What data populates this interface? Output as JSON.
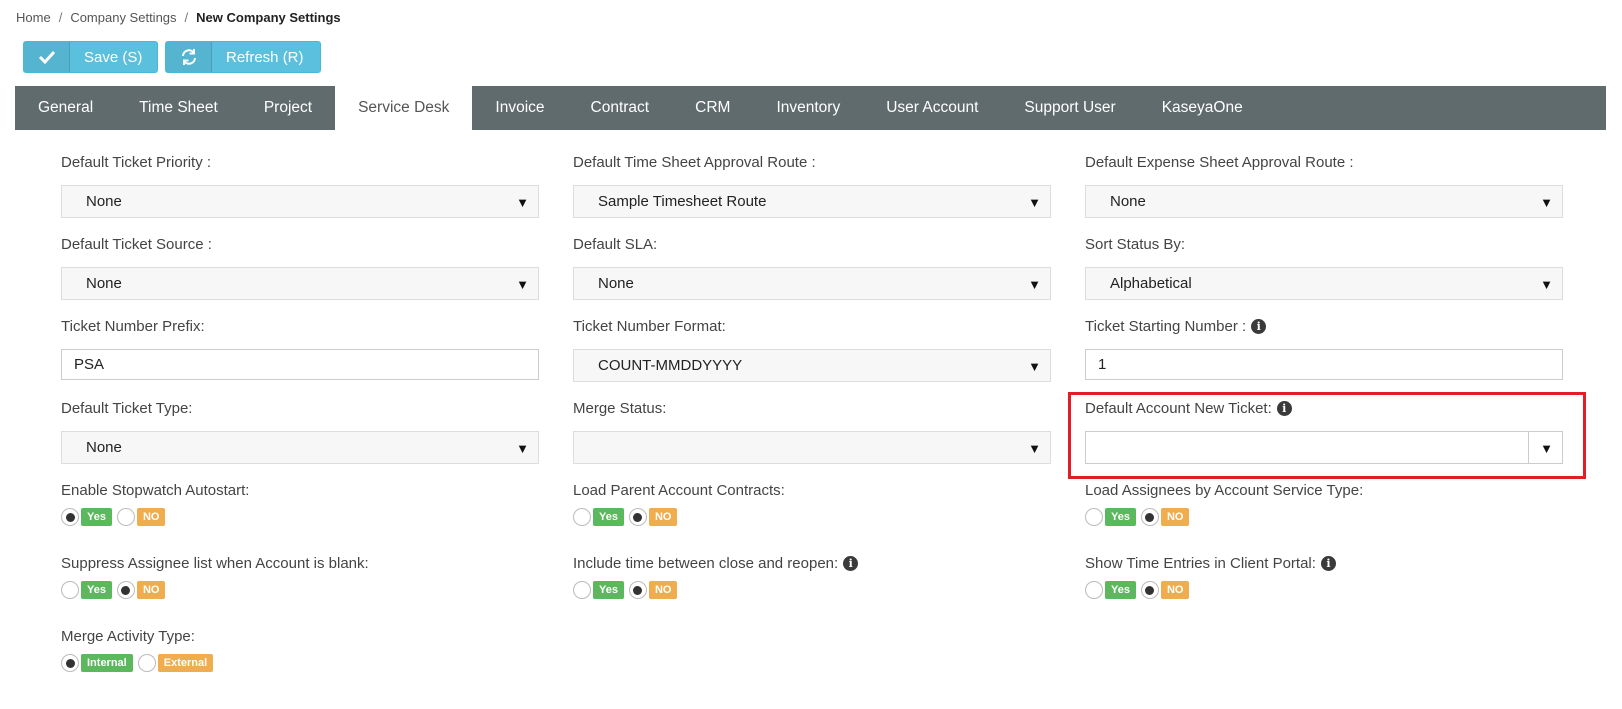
{
  "breadcrumb": {
    "home": "Home",
    "sep1": "/",
    "company": "Company Settings",
    "sep2": "/",
    "current": "New Company Settings"
  },
  "toolbar": {
    "save_label": "Save (S)",
    "refresh_label": "Refresh (R)"
  },
  "tabs": [
    "General",
    "Time Sheet",
    "Project",
    "Service Desk",
    "Invoice",
    "Contract",
    "CRM",
    "Inventory",
    "User Account",
    "Support User",
    "KaseyaOne"
  ],
  "active_tab": "Service Desk",
  "fields": {
    "default_ticket_priority": {
      "label": "Default Ticket Priority :",
      "value": "None"
    },
    "default_timesheet_route": {
      "label": "Default Time Sheet Approval Route :",
      "value": "Sample Timesheet Route"
    },
    "default_expense_route": {
      "label": "Default Expense Sheet Approval Route :",
      "value": "None"
    },
    "default_ticket_source": {
      "label": "Default Ticket Source :",
      "value": "None"
    },
    "default_sla": {
      "label": "Default SLA:",
      "value": "None"
    },
    "sort_status_by": {
      "label": "Sort Status By:",
      "value": "Alphabetical"
    },
    "ticket_number_prefix": {
      "label": "Ticket Number Prefix:",
      "value": "PSA"
    },
    "ticket_number_format": {
      "label": "Ticket Number Format:",
      "value": "COUNT-MMDDYYYY"
    },
    "ticket_starting_number": {
      "label": "Ticket Starting Number :",
      "value": "1"
    },
    "default_ticket_type": {
      "label": "Default Ticket Type:",
      "value": "None"
    },
    "merge_status": {
      "label": "Merge Status:",
      "value": ""
    },
    "default_account_new_ticket": {
      "label": "Default Account New Ticket:",
      "value": ""
    },
    "enable_stopwatch_autostart": {
      "label": "Enable Stopwatch Autostart:",
      "yes": "Yes",
      "no": "NO",
      "selected": "Yes"
    },
    "load_parent_account_contracts": {
      "label": "Load Parent Account Contracts:",
      "yes": "Yes",
      "no": "NO",
      "selected": "NO"
    },
    "load_assignees_by_service_type": {
      "label": "Load Assignees by Account Service Type:",
      "yes": "Yes",
      "no": "NO",
      "selected": "NO"
    },
    "suppress_assignee_list": {
      "label": "Suppress Assignee list when Account is blank:",
      "yes": "Yes",
      "no": "NO",
      "selected": "NO"
    },
    "include_time_close_reopen": {
      "label": "Include time between close and reopen:",
      "yes": "Yes",
      "no": "NO",
      "selected": "NO"
    },
    "show_time_entries_portal": {
      "label": "Show Time Entries in Client Portal:",
      "yes": "Yes",
      "no": "NO",
      "selected": "NO"
    },
    "merge_activity_type": {
      "label": "Merge Activity Type:",
      "internal": "Internal",
      "external": "External",
      "selected": "Internal"
    }
  },
  "icons": {
    "save": "check-icon",
    "refresh": "refresh-icon",
    "dropdown": "caret-down-icon",
    "info": "info-icon"
  },
  "colors": {
    "accent": "#5bc0de",
    "tab_bar": "#5f6b6d",
    "yes_tag": "#5cb85c",
    "no_tag": "#f0ad4e",
    "highlight": "#e31c25"
  },
  "glyphs": {
    "arrow": "▼",
    "info": "i"
  }
}
